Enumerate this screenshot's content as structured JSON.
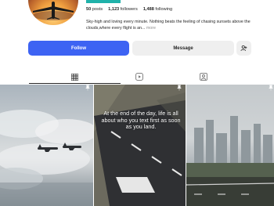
{
  "profile": {
    "stats": {
      "posts_count": "50",
      "posts_label": "posts",
      "followers_count": "1,123",
      "followers_label": "followers",
      "following_count": "1,488",
      "following_label": "following"
    },
    "bio_text": "Sky-high and loving every minute. Nothing beats the feeling of chasing sunsets above the clouds,where every flight is an...",
    "bio_more": "more"
  },
  "actions": {
    "follow_label": "Follow",
    "message_label": "Message",
    "add_user_icon": "person-plus-icon"
  },
  "tabs": [
    {
      "icon": "grid-icon",
      "active": true
    },
    {
      "icon": "reels-icon",
      "active": false
    },
    {
      "icon": "tagged-icon",
      "active": false
    }
  ],
  "posts": [
    {
      "type": "photo",
      "pinned": true,
      "alt_icon": "pin-icon"
    },
    {
      "type": "photo",
      "pinned": true,
      "alt_icon": "pin-icon",
      "caption": "At the end of the day, life is all about who you text first as soon as you land."
    },
    {
      "type": "photo",
      "pinned": true,
      "alt_icon": "pin-icon"
    }
  ],
  "colors": {
    "accent": "#3d63f3",
    "teal": "#20b2aa",
    "button_gray": "#efefef",
    "text": "#262626",
    "muted": "#8e8e8e"
  }
}
